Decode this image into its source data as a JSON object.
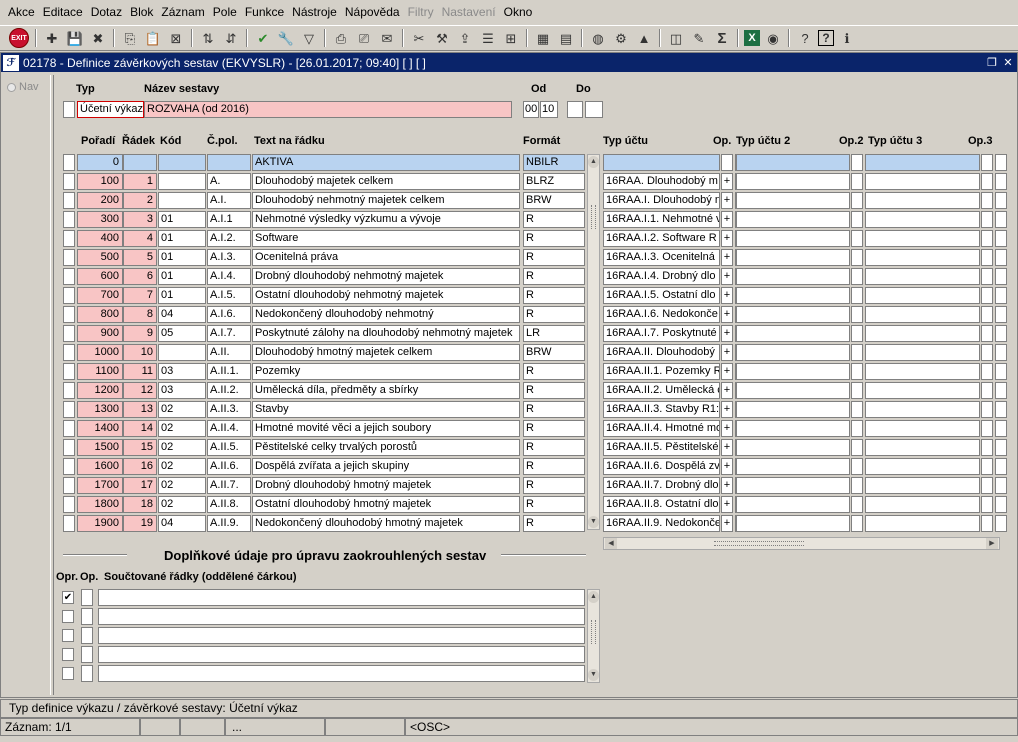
{
  "menu": [
    "Akce",
    "Editace",
    "Dotaz",
    "Blok",
    "Záznam",
    "Pole",
    "Funkce",
    "Nástroje",
    "Nápověda",
    "Filtry",
    "Nastavení",
    "Okno"
  ],
  "menu_disabled": [
    "Filtry",
    "Nastavení"
  ],
  "toolbar": {
    "exit_label": "EXIT",
    "icons": [
      "add-record-icon",
      "save-record-icon",
      "delete-record-icon",
      "copy-icon",
      "paste-icon",
      "print-delete-icon",
      "sort-asc-icon",
      "sort-desc-icon",
      "check-icon",
      "wrench-icon",
      "filter-icon",
      "printer-icon",
      "printer-setup-icon",
      "envelope-icon",
      "scissors-icon",
      "tools-icon",
      "export-icon",
      "list-icon",
      "tree-icon",
      "calculator-icon",
      "document-icon",
      "globe-icon",
      "gear-icon",
      "mountain-icon",
      "chart-icon",
      "edit-icon",
      "sigma-icon",
      "excel-icon",
      "help-browser-icon",
      "help-icon",
      "help-question-icon",
      "info-icon"
    ]
  },
  "window": {
    "title": "02178 - Definice závěrkových sestav (EKVYSLR) - [26.01.2017; 09:40]  [ ]  [ ]",
    "nav_label": "Nav"
  },
  "header": {
    "typ_label": "Typ",
    "nazev_label": "Název sestavy",
    "od_label": "Od",
    "do_label": "Do",
    "typ_value": "Účetní výkaz",
    "nazev_value": "ROZVAHA (od 2016)",
    "od_value1": "00",
    "od_value2": "10",
    "do_value1": "",
    "do_value2": ""
  },
  "table": {
    "columns": {
      "poradi": "Pořadí",
      "radek": "Řádek",
      "kod": "Kód",
      "cpol": "Č.pol.",
      "text": "Text na řádku",
      "format": "Formát",
      "typ_uctu": "Typ účtu",
      "op": "Op.",
      "typ_uctu2": "Typ účtu 2",
      "op2": "Op.2",
      "typ_uctu3": "Typ účtu 3",
      "op3": "Op.3"
    },
    "rows": [
      {
        "poradi": "0",
        "radek": "",
        "kod": "",
        "cpol": "",
        "text": "AKTIVA",
        "format": "NBILR",
        "typ": "",
        "op": ""
      },
      {
        "poradi": "100",
        "radek": "1",
        "kod": "",
        "cpol": "A.",
        "text": "Dlouhodobý majetek celkem",
        "format": "BLRZ",
        "typ": "16RAA.  Dlouhodobý m",
        "op": "+"
      },
      {
        "poradi": "200",
        "radek": "2",
        "kod": "",
        "cpol": "A.I.",
        "text": "Dlouhodobý nehmotný majetek celkem",
        "format": "BRW",
        "typ": "16RAA.I.  Dlouhodobý n",
        "op": "+"
      },
      {
        "poradi": "300",
        "radek": "3",
        "kod": "01",
        "cpol": "A.I.1",
        "text": "Nehmotné výsledky výzkumu a vývoje",
        "format": "R",
        "typ": "16RAA.I.1.  Nehmotné v",
        "op": "+"
      },
      {
        "poradi": "400",
        "radek": "4",
        "kod": "01",
        "cpol": "A.I.2.",
        "text": "Software",
        "format": "R",
        "typ": "16RAA.I.2.  Software R",
        "op": "+"
      },
      {
        "poradi": "500",
        "radek": "5",
        "kod": "01",
        "cpol": "A.I.3.",
        "text": "Ocenitelná práva",
        "format": "R",
        "typ": "16RAA.I.3.  Ocenitelná",
        "op": "+"
      },
      {
        "poradi": "600",
        "radek": "6",
        "kod": "01",
        "cpol": "A.I.4.",
        "text": "Drobný dlouhodobý nehmotný majetek",
        "format": "R",
        "typ": "16RAA.I.4.  Drobný dlo",
        "op": "+"
      },
      {
        "poradi": "700",
        "radek": "7",
        "kod": "01",
        "cpol": "A.I.5.",
        "text": "Ostatní dlouhodobý nehmotný majetek",
        "format": "R",
        "typ": "16RAA.I.5.  Ostatní dlo",
        "op": "+"
      },
      {
        "poradi": "800",
        "radek": "8",
        "kod": "04",
        "cpol": "A.I.6.",
        "text": "Nedokončený dlouhodobý nehmotný",
        "format": "R",
        "typ": "16RAA.I.6.  Nedokonče",
        "op": "+"
      },
      {
        "poradi": "900",
        "radek": "9",
        "kod": "05",
        "cpol": "A.I.7.",
        "text": "Poskytnuté zálohy na dlouhodobý nehmotný majetek",
        "format": "LR",
        "typ": "16RAA.I.7.  Poskytnuté",
        "op": "+"
      },
      {
        "poradi": "1000",
        "radek": "10",
        "kod": "",
        "cpol": "A.II.",
        "text": "Dlouhodobý hmotný majetek celkem",
        "format": "BRW",
        "typ": "16RAA.II.  Dlouhodobý",
        "op": "+"
      },
      {
        "poradi": "1100",
        "radek": "11",
        "kod": "03",
        "cpol": "A.II.1.",
        "text": "Pozemky",
        "format": "R",
        "typ": "16RAA.II.1.  Pozemky R",
        "op": "+"
      },
      {
        "poradi": "1200",
        "radek": "12",
        "kod": "03",
        "cpol": "A.II.2.",
        "text": "Umělecká díla, předměty a sbírky",
        "format": "R",
        "typ": "16RAA.II.2.  Umělecká c",
        "op": "+"
      },
      {
        "poradi": "1300",
        "radek": "13",
        "kod": "02",
        "cpol": "A.II.3.",
        "text": "Stavby",
        "format": "R",
        "typ": "16RAA.II.3.  Stavby R1:",
        "op": "+"
      },
      {
        "poradi": "1400",
        "radek": "14",
        "kod": "02",
        "cpol": "A.II.4.",
        "text": "Hmotné movité věci a jejich soubory",
        "format": "R",
        "typ": "16RAA.II.4.  Hmotné mo",
        "op": "+"
      },
      {
        "poradi": "1500",
        "radek": "15",
        "kod": "02",
        "cpol": "A.II.5.",
        "text": "Pěstitelské celky trvalých porostů",
        "format": "R",
        "typ": "16RAA.II.5.  Pěstitelské",
        "op": "+"
      },
      {
        "poradi": "1600",
        "radek": "16",
        "kod": "02",
        "cpol": "A.II.6.",
        "text": "Dospělá zvířata a jejich skupiny",
        "format": "R",
        "typ": "16RAA.II.6.  Dospělá zv",
        "op": "+"
      },
      {
        "poradi": "1700",
        "radek": "17",
        "kod": "02",
        "cpol": "A.II.7.",
        "text": "Drobný dlouhodobý hmotný majetek",
        "format": "R",
        "typ": "16RAA.II.7.  Drobný dlo",
        "op": "+"
      },
      {
        "poradi": "1800",
        "radek": "18",
        "kod": "02",
        "cpol": "A.II.8.",
        "text": "Ostatní dlouhodobý hmotný majetek",
        "format": "R",
        "typ": "16RAA.II.8.  Ostatní dlo",
        "op": "+"
      },
      {
        "poradi": "1900",
        "radek": "19",
        "kod": "04",
        "cpol": "A.II.9.",
        "text": "Nedokončený dlouhodobý hmotný majetek",
        "format": "R",
        "typ": "16RAA.II.9.  Nedokonče",
        "op": "+"
      }
    ]
  },
  "supplement": {
    "title": "Doplňkové údaje pro úpravu zaokrouhlených sestav",
    "col_opr": "Opr.",
    "col_op": "Op.",
    "col_rows": "Součtované řádky (oddělené čárkou)",
    "rows": [
      {
        "opr": "✔",
        "op": "",
        "value": ""
      },
      {
        "opr": "",
        "op": "",
        "value": ""
      },
      {
        "opr": "",
        "op": "",
        "value": ""
      },
      {
        "opr": "",
        "op": "",
        "value": ""
      },
      {
        "opr": "",
        "op": "",
        "value": ""
      }
    ]
  },
  "status": {
    "hint": "Typ definice výkazu / závěrkové sestavy: Účetní výkaz",
    "record": "Záznam: 1/1",
    "ellipsis": "...",
    "osc": "<OSC>"
  },
  "colors": {
    "pink": "#f8c5c5",
    "blue_selected": "#b9d3f0",
    "title_bar": "#0a246a"
  }
}
